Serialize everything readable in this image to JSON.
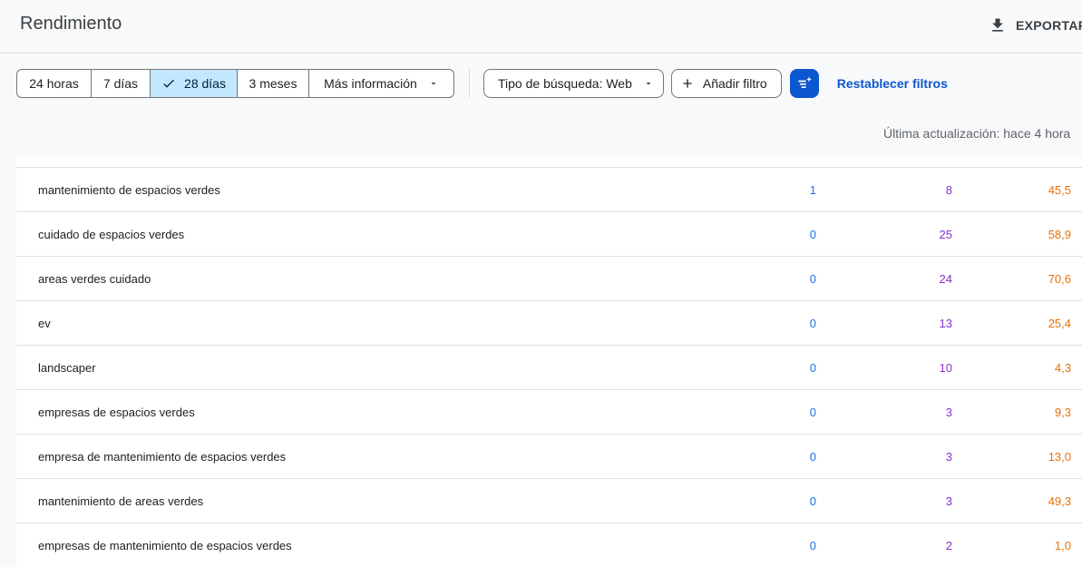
{
  "header": {
    "title": "Rendimiento",
    "export_label": "EXPORTAR"
  },
  "date_range": {
    "options": [
      "24 horas",
      "7 días",
      "28 días",
      "3 meses"
    ],
    "selected": "28 días",
    "more_label": "Más información"
  },
  "filters": {
    "search_type_label": "Tipo de búsqueda: Web",
    "add_filter_label": "Añadir filtro",
    "reset_label": "Restablecer filtros"
  },
  "last_update": "Última actualización: hace 4 hora",
  "colors": {
    "clicks": "#1a73e8",
    "impressions": "#8430ce",
    "position": "#e8710a",
    "selected_segment": "#c2e7ff",
    "primary": "#0b57d0"
  },
  "rows": [
    {
      "query": "mantenimiento de espacios verdes",
      "clicks": "1",
      "impressions": "8",
      "position": "45,5"
    },
    {
      "query": "cuidado de espacios verdes",
      "clicks": "0",
      "impressions": "25",
      "position": "58,9"
    },
    {
      "query": "areas verdes cuidado",
      "clicks": "0",
      "impressions": "24",
      "position": "70,6"
    },
    {
      "query": "ev",
      "clicks": "0",
      "impressions": "13",
      "position": "25,4"
    },
    {
      "query": "landscaper",
      "clicks": "0",
      "impressions": "10",
      "position": "4,3"
    },
    {
      "query": "empresas de espacios verdes",
      "clicks": "0",
      "impressions": "3",
      "position": "9,3"
    },
    {
      "query": "empresa de mantenimiento de espacios verdes",
      "clicks": "0",
      "impressions": "3",
      "position": "13,0"
    },
    {
      "query": "mantenimiento de areas verdes",
      "clicks": "0",
      "impressions": "3",
      "position": "49,3"
    },
    {
      "query": "empresas de mantenimiento de espacios verdes",
      "clicks": "0",
      "impressions": "2",
      "position": "1,0"
    }
  ]
}
